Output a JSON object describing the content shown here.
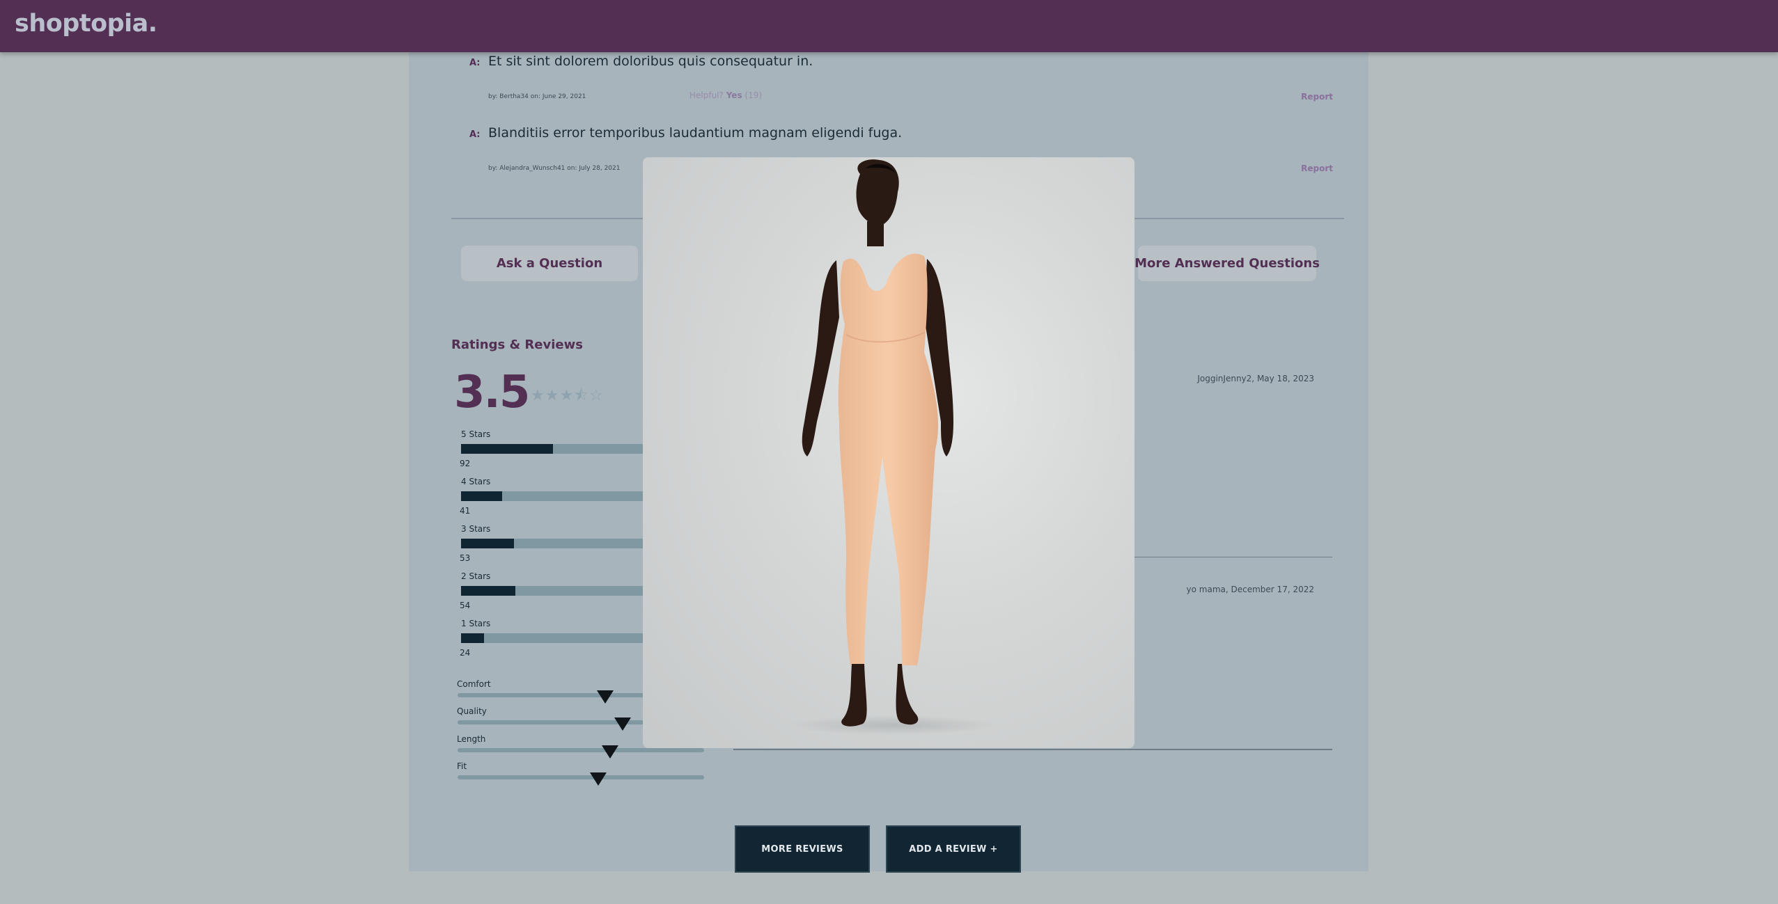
{
  "header": {
    "logo": "shoptopia."
  },
  "answers": [
    {
      "tag": "A:",
      "body": "Et sit sint dolorem doloribus quis consequatur in.",
      "meta": "by: Bertha34 on: June 29, 2021",
      "helpful_label": "Helpful?",
      "helpful_yes": "Yes",
      "helpful_count": "(19)",
      "report": "Report"
    },
    {
      "tag": "A:",
      "body": "Blanditiis error temporibus laudantium magnam eligendi fuga.",
      "meta": "by: Alejandra_Wunsch41 on: July 28, 2021",
      "report": "Report"
    }
  ],
  "qa_buttons": {
    "ask": "Ask a Question",
    "more": "More Answered Questions"
  },
  "ratings": {
    "title": "Ratings & Reviews",
    "average": "3.5",
    "stars_glyphs": "★★★⯪☆",
    "average_value": 3.5,
    "breakdown": [
      {
        "label": "5 Stars",
        "count": "92",
        "fraction": 0.4
      },
      {
        "label": "4 Stars",
        "count": "41",
        "fraction": 0.18
      },
      {
        "label": "3 Stars",
        "count": "53",
        "fraction": 0.23
      },
      {
        "label": "2 Stars",
        "count": "54",
        "fraction": 0.235
      },
      {
        "label": "1 Stars",
        "count": "24",
        "fraction": 0.1
      }
    ],
    "characteristics": [
      {
        "label": "Comfort",
        "level": 0.6
      },
      {
        "label": "Quality",
        "level": 0.67
      },
      {
        "label": "Length",
        "level": 0.62
      },
      {
        "label": "Fit",
        "level": 0.57
      }
    ]
  },
  "reviews": [
    {
      "author": "JogginJenny2,",
      "date": "May 18, 2023"
    },
    {
      "author": "yo mama,",
      "date": "December 17, 2022"
    }
  ],
  "review_buttons": {
    "more": "MORE REVIEWS",
    "add": "ADD A REVIEW +"
  },
  "modal": {
    "image_desc_icon": "product-photo"
  },
  "colors": {
    "brand": "#532f54",
    "page_bg": "#a7b4bb",
    "dark_button": "#112533",
    "bar_fill": "#0f2531",
    "bar_track": "#7f98a2"
  }
}
